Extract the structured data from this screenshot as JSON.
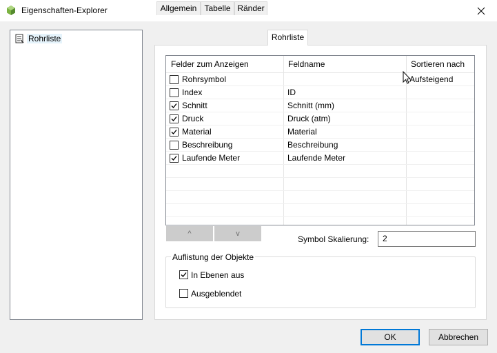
{
  "window": {
    "title": "Eigenschaften-Explorer"
  },
  "tree": {
    "items": [
      {
        "label": "Rohrliste"
      }
    ]
  },
  "tabs": [
    {
      "label": "Allgemein",
      "active": false
    },
    {
      "label": "Tabelle",
      "active": false
    },
    {
      "label": "Ränder",
      "active": false
    },
    {
      "label": "Rohrliste",
      "active": true
    }
  ],
  "grid": {
    "columns": [
      "Felder zum Anzeigen",
      "Feldname",
      "Sortieren nach"
    ],
    "rows": [
      {
        "checked": false,
        "field": "Rohrsymbol",
        "name": "",
        "sort": "Aufsteigend"
      },
      {
        "checked": false,
        "field": "Index",
        "name": "ID",
        "sort": ""
      },
      {
        "checked": true,
        "field": "Schnitt",
        "name": "Schnitt (mm)",
        "sort": ""
      },
      {
        "checked": true,
        "field": "Druck",
        "name": "Druck (atm)",
        "sort": ""
      },
      {
        "checked": true,
        "field": "Material",
        "name": "Material",
        "sort": ""
      },
      {
        "checked": false,
        "field": "Beschreibung",
        "name": "Beschreibung",
        "sort": ""
      },
      {
        "checked": true,
        "field": "Laufende Meter",
        "name": "Laufende Meter",
        "sort": ""
      }
    ]
  },
  "move_buttons": {
    "up": "^",
    "down": "v"
  },
  "scaling": {
    "label": "Symbol Skalierung:",
    "value": "2"
  },
  "listing_group": {
    "title": "Auflistung der Objekte",
    "options": [
      {
        "label": "In Ebenen aus",
        "checked": true
      },
      {
        "label": "Ausgeblendet",
        "checked": false
      }
    ]
  },
  "buttons": {
    "ok": "OK",
    "cancel": "Abbrechen"
  },
  "colors": {
    "accent": "#0078d7",
    "selection": "#e5f3fb",
    "app_icon": "#7cb342"
  }
}
